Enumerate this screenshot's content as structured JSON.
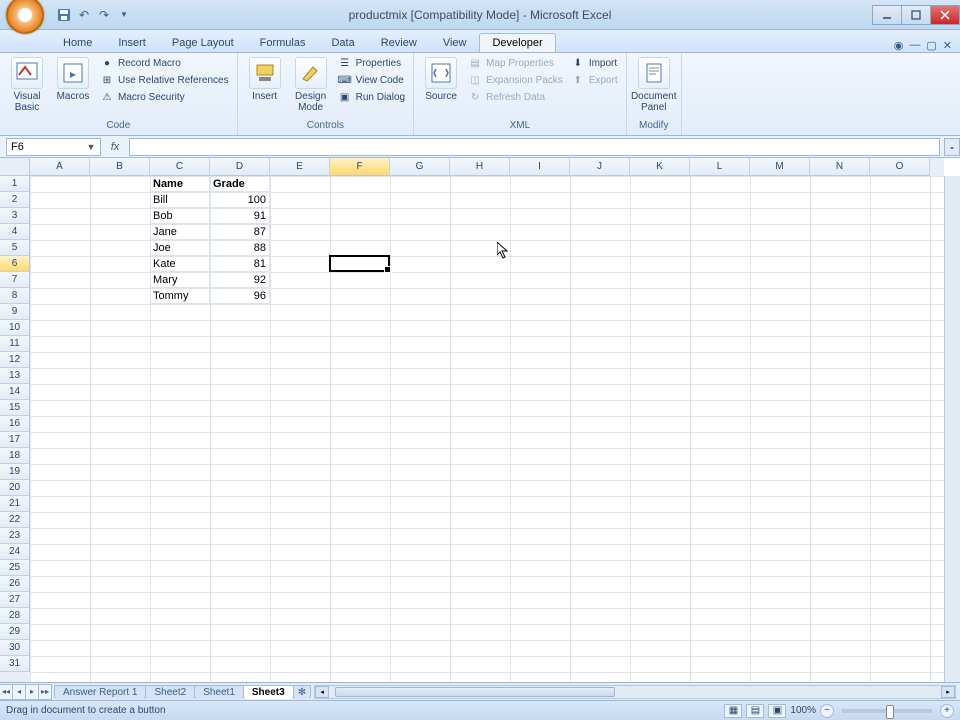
{
  "title": "productmix [Compatibility Mode] - Microsoft Excel",
  "tabs": [
    "Home",
    "Insert",
    "Page Layout",
    "Formulas",
    "Data",
    "Review",
    "View",
    "Developer"
  ],
  "active_tab": 7,
  "ribbon": {
    "code": {
      "label": "Code",
      "visual_basic": "Visual\nBasic",
      "macros": "Macros",
      "record": "Record Macro",
      "use_rel": "Use Relative References",
      "security": "Macro Security"
    },
    "controls": {
      "label": "Controls",
      "insert": "Insert",
      "design": "Design\nMode",
      "properties": "Properties",
      "view_code": "View Code",
      "run_dialog": "Run Dialog"
    },
    "xml": {
      "label": "XML",
      "source": "Source",
      "map": "Map Properties",
      "expansion": "Expansion Packs",
      "refresh": "Refresh Data",
      "import": "Import",
      "export": "Export"
    },
    "modify": {
      "label": "Modify",
      "doc_panel": "Document\nPanel"
    }
  },
  "namebox": "F6",
  "formula": "",
  "columns": [
    "A",
    "B",
    "C",
    "D",
    "E",
    "F",
    "G",
    "H",
    "I",
    "J",
    "K",
    "L",
    "M",
    "N",
    "O"
  ],
  "rows_count": 31,
  "active_col": 5,
  "active_row": 6,
  "selection": {
    "col": 5,
    "row": 6
  },
  "headers": {
    "c": "Name",
    "d": "Grade"
  },
  "chart_data": {
    "type": "table",
    "columns": [
      "Name",
      "Grade"
    ],
    "rows": [
      {
        "name": "Bill",
        "grade": 100
      },
      {
        "name": "Bob",
        "grade": 91
      },
      {
        "name": "Jane",
        "grade": 87
      },
      {
        "name": "Joe",
        "grade": 88
      },
      {
        "name": "Kate",
        "grade": 81
      },
      {
        "name": "Mary",
        "grade": 92
      },
      {
        "name": "Tommy",
        "grade": 96
      }
    ]
  },
  "sheets": [
    "Answer Report 1",
    "Sheet2",
    "Sheet1",
    "Sheet3"
  ],
  "active_sheet": 3,
  "status": "Drag in document to create a button",
  "zoom": "100%"
}
